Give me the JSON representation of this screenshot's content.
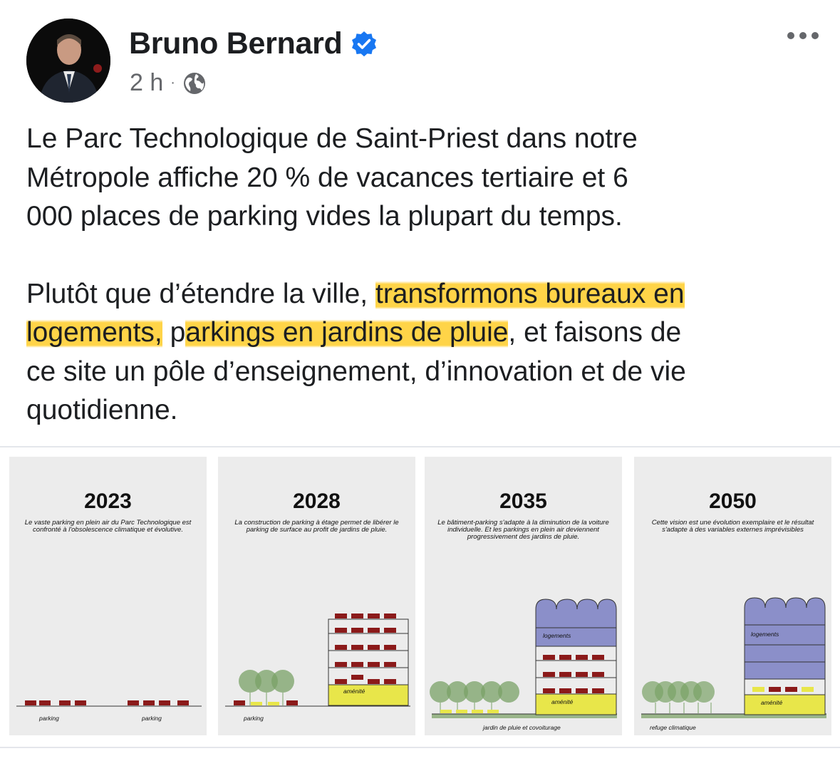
{
  "post": {
    "author": "Bruno Bernard",
    "time": "2 h",
    "separator": "·",
    "icons": {
      "verified": "verified-badge-icon",
      "audience": "globe-icon",
      "more": "more-options-icon"
    },
    "paragraph_1": "Le Parc Technologique de Saint-Priest dans notre\nMétropole affiche 20 % de vacances tertiaire et 6\n000 places de parking vides la plupart du temps.",
    "paragraph_2": {
      "part_1": "Plutôt que d’étendre la ville, ",
      "highlight_1": "transformons bureaux en\nlogements,",
      "part_2": " p",
      "highlight_2": "arkings en jardins de pluie",
      "part_3": ", et faisons de\nce site un pôle d’enseignement, d’innovation et de vie\nquotidienne."
    }
  },
  "panels": [
    {
      "year": "2023",
      "desc": "Le vaste parking en plein air du Parc Technologique est confronté à l'obsolescence climatique et évolutive.",
      "labels": [
        "parking",
        "parking"
      ]
    },
    {
      "year": "2028",
      "desc": "La construction de parking à étage permet de libérer le parking de surface au profit de jardins de pluie.",
      "labels": [
        "aménité",
        "parking"
      ]
    },
    {
      "year": "2035",
      "desc": "Le bâtiment-parking s'adapte à la diminution de la voiture individuelle. Et les parkings en plein air deviennent progressivement des jardins de pluie.",
      "labels": [
        "logements",
        "aménité",
        "jardin de pluie et covoiturage"
      ]
    },
    {
      "year": "2050",
      "desc": "Cette vision est une évolution exemplaire et le résultat s'adapte à des variables externes imprévisibles",
      "labels": [
        "logements",
        "aménité",
        "refuge climatique"
      ]
    }
  ],
  "colors": {
    "highlight": "#ffcd28",
    "verified": "#1877f2",
    "car": "#8b1a1a",
    "amenity": "#e8e64a",
    "housing": "#8b8fc9",
    "tree": "#7aa267",
    "ground": "#9ab58a"
  }
}
